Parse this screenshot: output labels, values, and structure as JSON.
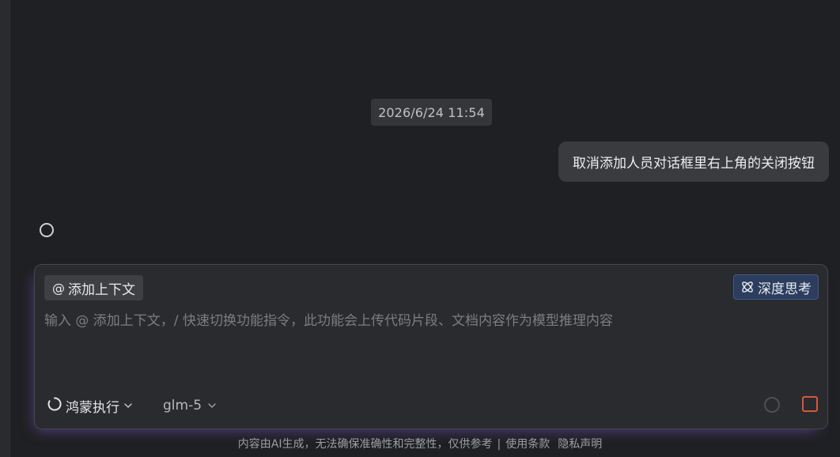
{
  "chat": {
    "timestamp": "2026/6/24 11:54",
    "user_message": "取消添加人员对话框里右上角的关闭按钮"
  },
  "input_panel": {
    "add_context": {
      "at_symbol": "@",
      "label": "添加上下文"
    },
    "deep_think_label": "深度思考",
    "placeholder": "输入 @ 添加上下文，/ 快速切换功能指令，此功能会上传代码片段、文档内容作为模型推理内容",
    "mode_label": "鸿蒙执行",
    "model_label": "glm-5"
  },
  "footer": {
    "disclaimer": "内容由AI生成，无法确保准确性和完整性，仅供参考",
    "separator": "|",
    "terms_link": "使用条款",
    "privacy_link": "隐私声明"
  },
  "colors": {
    "background": "#1f2023",
    "panel": "#2a2b2e",
    "accent_blue": "#2c3d5d",
    "stop_red": "#d5563f",
    "glow_purple": "#8c60e6"
  },
  "icons": {
    "deep_think": "atom-icon",
    "mode": "harmony-ring-icon",
    "dropdown": "chevron-down-icon",
    "spinner": "loading-ring-icon",
    "stop": "stop-square-icon"
  }
}
